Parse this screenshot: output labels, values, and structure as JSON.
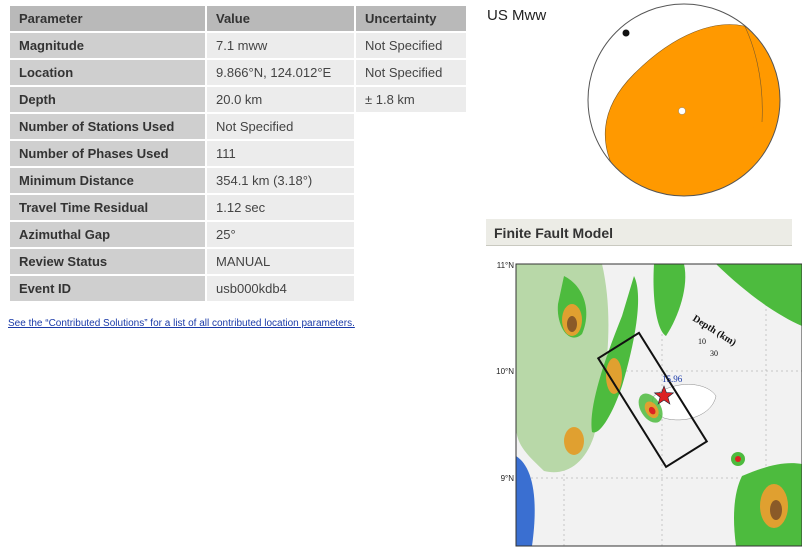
{
  "table": {
    "headers": [
      "Parameter",
      "Value",
      "Uncertainty"
    ],
    "rows": [
      {
        "param": "Magnitude",
        "value": "7.1 mww",
        "uncertainty": "Not Specified"
      },
      {
        "param": "Location",
        "value": "9.866°N, 124.012°E",
        "uncertainty": "Not Specified"
      },
      {
        "param": "Depth",
        "value": "20.0 km",
        "uncertainty": "± 1.8 km"
      },
      {
        "param": "Number of Stations Used",
        "value": "Not Specified"
      },
      {
        "param": "Number of Phases Used",
        "value": "111"
      },
      {
        "param": "Minimum Distance",
        "value": "354.1 km (3.18°)"
      },
      {
        "param": "Travel Time Residual",
        "value": "1.12 sec"
      },
      {
        "param": "Azimuthal Gap",
        "value": "25°"
      },
      {
        "param": "Review Status",
        "value": "MANUAL"
      },
      {
        "param": "Event ID",
        "value": "usb000kdb4"
      }
    ]
  },
  "contrib_link": "See the “Contributed Solutions” for a list of all contributed location parameters.",
  "moment_tensor": {
    "label": "US Mww",
    "compression_color": "#ff9900",
    "dilatation_color": "#ffffff"
  },
  "finite_fault": {
    "title": "Finite Fault Model",
    "lat_labels": [
      "11°N",
      "10°N",
      "9°N"
    ],
    "depth_label": "Depth (km)",
    "depth_ticks": [
      "10",
      "30"
    ],
    "slip_label": "15.96",
    "colors": {
      "land_low": "#4dbb3e",
      "land_mid": "#e0a030",
      "land_high": "#8a5a28",
      "sea": "#f2f2f2",
      "epicenter": "#dd2222"
    }
  }
}
